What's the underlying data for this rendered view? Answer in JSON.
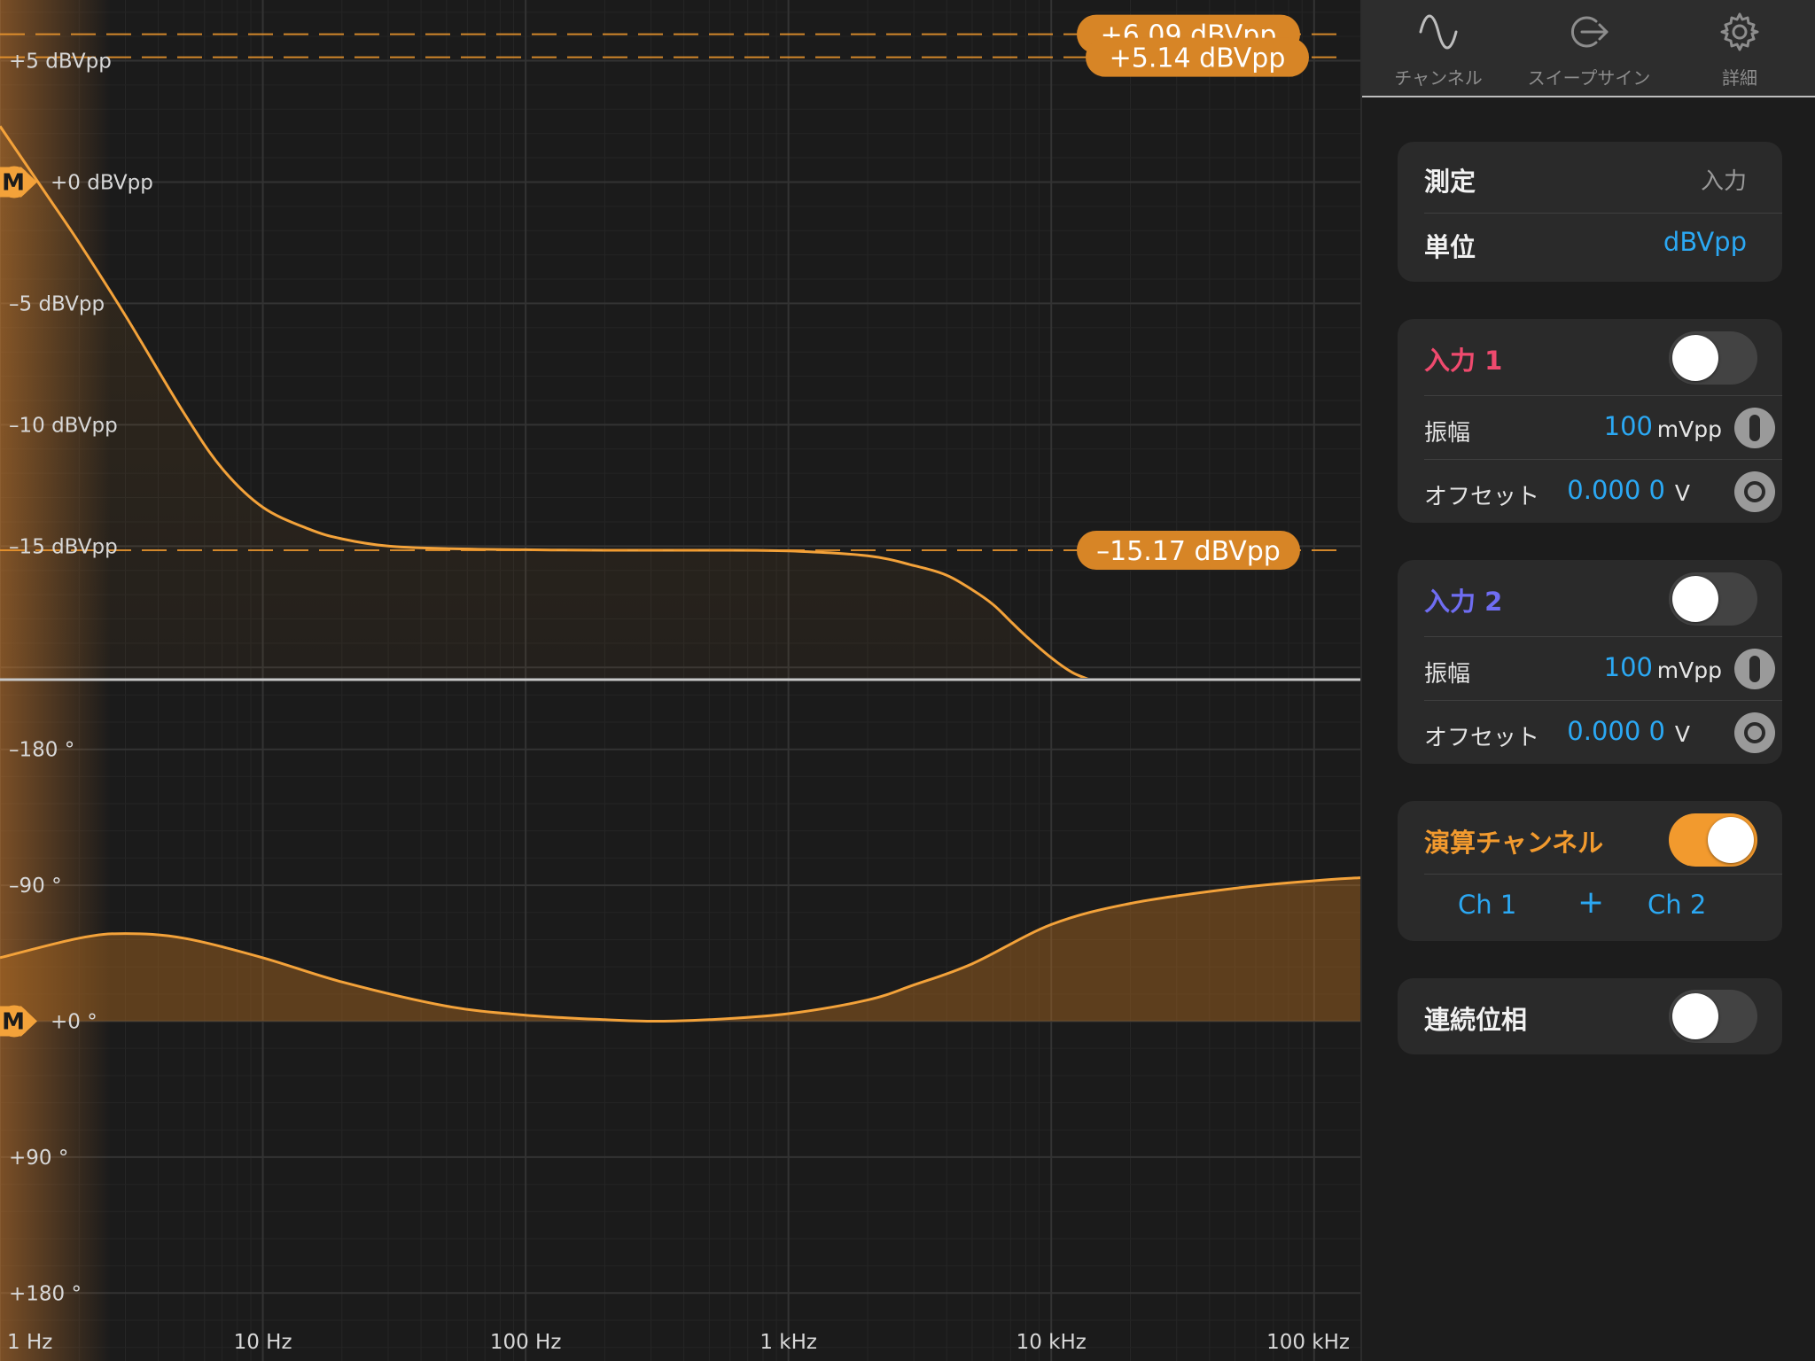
{
  "colors": {
    "accent": "#f29a2e",
    "curve": "#f3a23a",
    "marker_bg": "#d78526",
    "blue": "#2ba8f3",
    "input1": "#ef4a6e",
    "input2": "#6f6df2"
  },
  "tabs": [
    {
      "label": "チャンネル",
      "icon": "sine-wave-icon"
    },
    {
      "label": "スイープサイン",
      "icon": "sweep-export-icon"
    },
    {
      "label": "詳細",
      "icon": "gear-icon"
    }
  ],
  "measure_card": {
    "measure_label": "測定",
    "measure_value": "入力",
    "unit_label": "単位",
    "unit_value": "dBVpp"
  },
  "input1": {
    "title": "入力 1",
    "enabled": false,
    "amplitude_label": "振幅",
    "amplitude_value": "100",
    "amplitude_unit": "mVpp",
    "offset_label": "オフセット",
    "offset_value": "0.000 0",
    "offset_unit": "V"
  },
  "input2": {
    "title": "入力 2",
    "enabled": false,
    "amplitude_label": "振幅",
    "amplitude_value": "100",
    "amplitude_unit": "mVpp",
    "offset_label": "オフセット",
    "offset_value": "0.000 0",
    "offset_unit": "V"
  },
  "math_card": {
    "title": "演算チャンネル",
    "enabled": true,
    "ch_a": "Ch 1",
    "operator": "+",
    "ch_b": "Ch 2"
  },
  "phase_card": {
    "title": "連続位相",
    "enabled": false
  },
  "chart_data": [
    {
      "type": "line",
      "title": "",
      "ylabel": "",
      "xlabel": "",
      "x_scale": "log",
      "xlim": [
        1,
        150000
      ],
      "ylim": [
        7.5,
        -20.5
      ],
      "x_ticks": [
        {
          "value": 1,
          "label": "1 Hz"
        },
        {
          "value": 10,
          "label": "10 Hz"
        },
        {
          "value": 100,
          "label": "100 Hz"
        },
        {
          "value": 1000,
          "label": "1 kHz"
        },
        {
          "value": 10000,
          "label": "10 kHz"
        },
        {
          "value": 100000,
          "label": "100 kHz"
        }
      ],
      "y_ticks": [
        {
          "value": 5,
          "label": "+5 dBVpp"
        },
        {
          "value": 0,
          "label": "+0 dBVpp"
        },
        {
          "value": -5,
          "label": "–5 dBVpp"
        },
        {
          "value": -10,
          "label": "–10 dBVpp"
        },
        {
          "value": -15,
          "label": "–15 dBVpp"
        }
      ],
      "markers": [
        {
          "value": 6.09,
          "label": "+6.09 dBVpp"
        },
        {
          "value": 5.14,
          "label": "+5.14 dBVpp"
        },
        {
          "value": -15.17,
          "label": "–15.17 dBVpp"
        }
      ],
      "reference_marker": {
        "label": "M",
        "value": 0
      },
      "series": [
        {
          "x": [
            1,
            1.5,
            2,
            3,
            5,
            7,
            10,
            15,
            20,
            30,
            50,
            100,
            200,
            500,
            1000,
            2000,
            3000,
            4000,
            5000,
            6000,
            7000,
            8000,
            10000,
            12000,
            14000
          ],
          "y": [
            2.3,
            -0.5,
            -2.5,
            -5.5,
            -9.5,
            -11.8,
            -13.4,
            -14.3,
            -14.7,
            -15.0,
            -15.1,
            -15.15,
            -15.17,
            -15.17,
            -15.2,
            -15.4,
            -15.8,
            -16.2,
            -16.8,
            -17.4,
            -18.1,
            -18.7,
            -19.6,
            -20.2,
            -20.5
          ]
        }
      ]
    },
    {
      "type": "line",
      "title": "",
      "ylabel": "",
      "xlabel": "",
      "x_scale": "log",
      "xlim": [
        1,
        150000
      ],
      "ylim": [
        -225,
        225
      ],
      "y_ticks": [
        {
          "value": 180,
          "label": "+180 °"
        },
        {
          "value": 90,
          "label": "+90 °"
        },
        {
          "value": 0,
          "label": "+0 °"
        },
        {
          "value": -90,
          "label": "–90 °"
        },
        {
          "value": -180,
          "label": "–180 °"
        }
      ],
      "reference_marker": {
        "label": "M",
        "value": 0
      },
      "series": [
        {
          "x": [
            1,
            2,
            3,
            5,
            10,
            20,
            50,
            100,
            200,
            300,
            500,
            1000,
            2000,
            3000,
            5000,
            10000,
            20000,
            50000,
            100000,
            150000
          ],
          "y": [
            -42,
            -55,
            -58,
            -55,
            -42,
            -26,
            -10,
            -4,
            -1,
            0,
            -1,
            -5,
            -14,
            -24,
            -38,
            -64,
            -78,
            -88,
            -93,
            -95
          ]
        }
      ]
    }
  ]
}
